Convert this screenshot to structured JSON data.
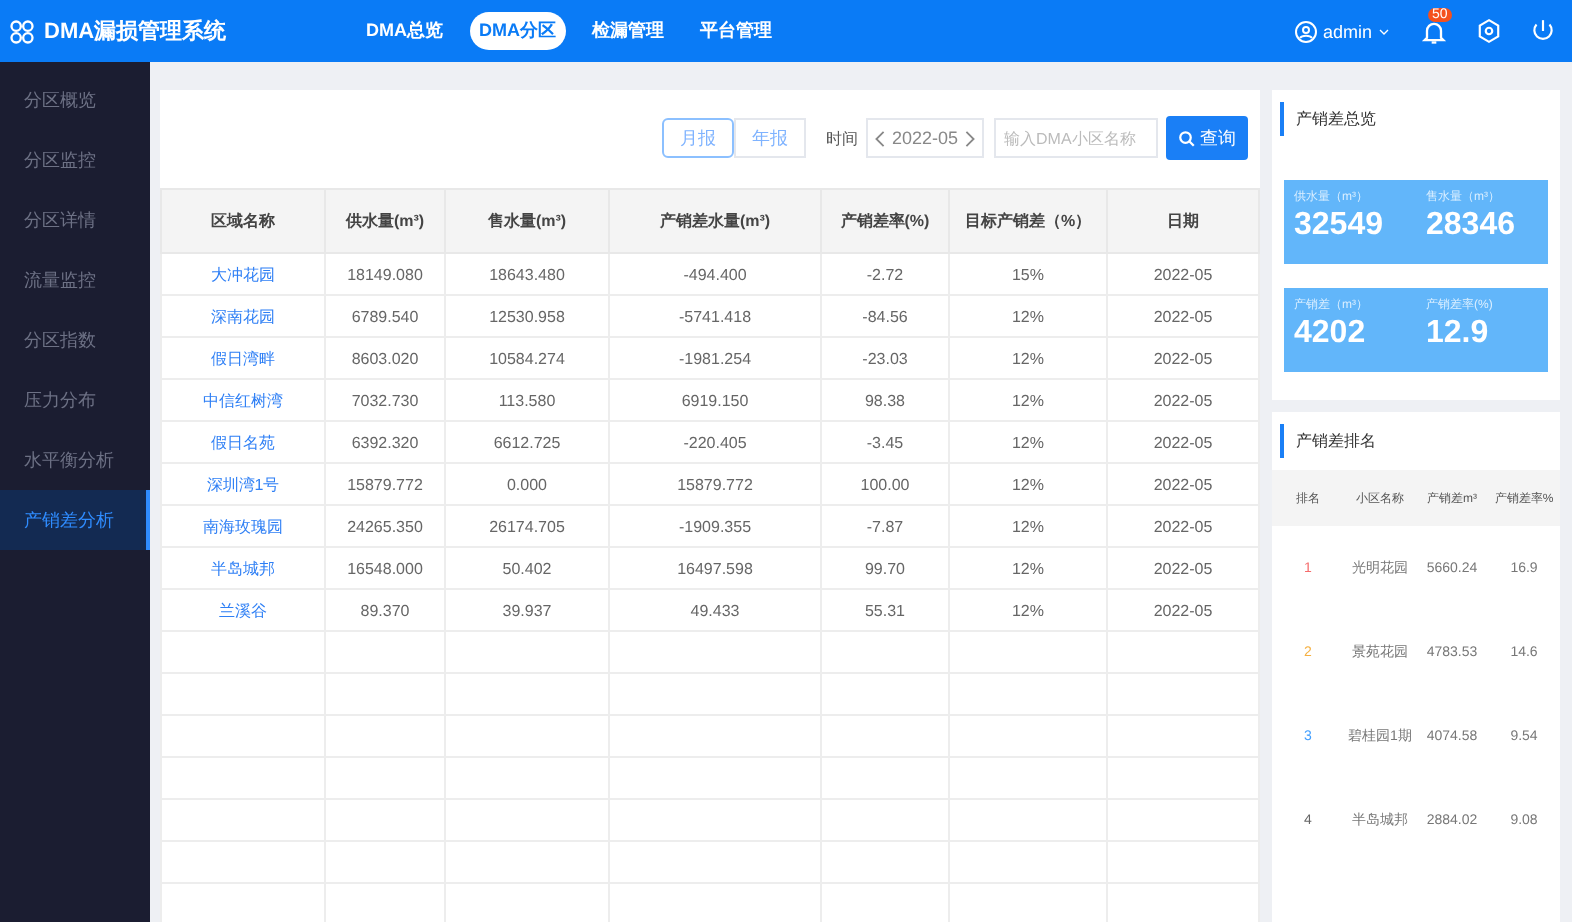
{
  "app_title": "DMA漏损管理系统",
  "top_nav": [
    {
      "label": "DMA总览",
      "selected": false
    },
    {
      "label": "DMA分区",
      "selected": true
    },
    {
      "label": "检漏管理",
      "selected": false
    },
    {
      "label": "平台管理",
      "selected": false
    }
  ],
  "user": {
    "name": "admin"
  },
  "notifications": {
    "badge": "50"
  },
  "sidebar": {
    "items": [
      {
        "label": "分区概览",
        "selected": false
      },
      {
        "label": "分区监控",
        "selected": false
      },
      {
        "label": "分区详情",
        "selected": false
      },
      {
        "label": "流量监控",
        "selected": false
      },
      {
        "label": "分区指数",
        "selected": false
      },
      {
        "label": "压力分布",
        "selected": false
      },
      {
        "label": "水平衡分析",
        "selected": false
      },
      {
        "label": "产销差分析",
        "selected": true
      }
    ]
  },
  "filters": {
    "period_tabs": [
      {
        "label": "月报",
        "selected": true
      },
      {
        "label": "年报",
        "selected": false
      }
    ],
    "time_label": "时间",
    "time_value": "2022-05",
    "search": {
      "placeholder": "输入DMA小区名称"
    },
    "query_button": "查询"
  },
  "table": {
    "columns": [
      "区域名称",
      "供水量(m³)",
      "售水量(m³)",
      "产销差水量(m³)",
      "产销差率(%)",
      "目标产销差（%）",
      "日期"
    ],
    "rows": [
      [
        "大冲花园",
        "18149.080",
        "18643.480",
        "-494.400",
        "-2.72",
        "15%",
        "2022-05"
      ],
      [
        "深南花园",
        "6789.540",
        "12530.958",
        "-5741.418",
        "-84.56",
        "12%",
        "2022-05"
      ],
      [
        "假日湾畔",
        "8603.020",
        "10584.274",
        "-1981.254",
        "-23.03",
        "12%",
        "2022-05"
      ],
      [
        "中信红树湾",
        "7032.730",
        "113.580",
        "6919.150",
        "98.38",
        "12%",
        "2022-05"
      ],
      [
        "假日名苑",
        "6392.320",
        "6612.725",
        "-220.405",
        "-3.45",
        "12%",
        "2022-05"
      ],
      [
        "深圳湾1号",
        "15879.772",
        "0.000",
        "15879.772",
        "100.00",
        "12%",
        "2022-05"
      ],
      [
        "南海玫瑰园",
        "24265.350",
        "26174.705",
        "-1909.355",
        "-7.87",
        "12%",
        "2022-05"
      ],
      [
        "半岛城邦",
        "16548.000",
        "50.402",
        "16497.598",
        "99.70",
        "12%",
        "2022-05"
      ],
      [
        "兰溪谷",
        "89.370",
        "39.937",
        "49.433",
        "55.31",
        "12%",
        "2022-05"
      ]
    ]
  },
  "summary": {
    "title": "产销差总览",
    "stats": [
      {
        "label": "供水量（m³）",
        "value": "32549"
      },
      {
        "label": "售水量（m³）",
        "value": "28346"
      },
      {
        "label": "产销差（m³）",
        "value": "4202"
      },
      {
        "label": "产销差率(%)",
        "value": "12.9"
      }
    ]
  },
  "ranking": {
    "title": "产销差排名",
    "columns": [
      "排名",
      "小区名称",
      "产销差m³",
      "产销差率%"
    ],
    "rows": [
      {
        "rank": "1",
        "color": "#f56c6c",
        "name": "光明花园",
        "diff": "5660.24",
        "rate": "16.9"
      },
      {
        "rank": "2",
        "color": "#f5b041",
        "name": "景苑花园",
        "diff": "4783.53",
        "rate": "14.6"
      },
      {
        "rank": "3",
        "color": "#409eff",
        "name": "碧桂园1期",
        "diff": "4074.58",
        "rate": "9.54"
      },
      {
        "rank": "4",
        "color": "#666666",
        "name": "半岛城邦",
        "diff": "2884.02",
        "rate": "9.08"
      }
    ]
  }
}
